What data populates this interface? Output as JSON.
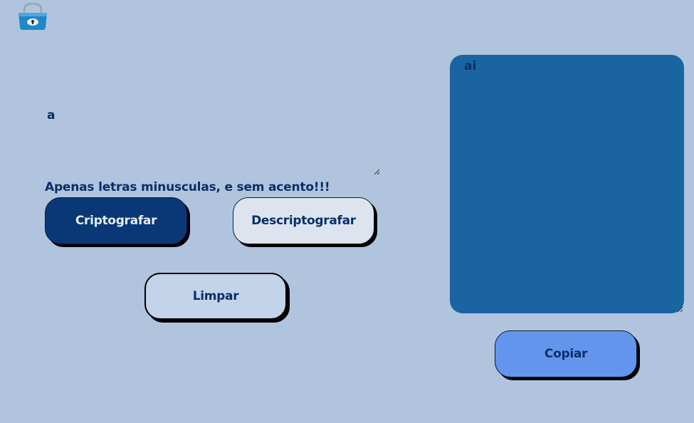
{
  "logo": {
    "icon": "padlock-icon"
  },
  "input": {
    "value": "a",
    "resize_icon": "resize-grip-icon"
  },
  "warning_text": "Apenas letras minusculas, e sem acento!!!",
  "buttons": {
    "encrypt_label": "Criptografar",
    "decrypt_label": "Descriptografar",
    "clear_label": "Limpar",
    "copy_label": "Copiar"
  },
  "output": {
    "value": "ai",
    "resize_icon": "resize-grip-icon"
  },
  "colors": {
    "background": "#b0c4de",
    "primary_dark": "#0a3877",
    "output_panel": "#1a64a1",
    "copy_button": "#6495ed",
    "text_dark": "#0a2f6a"
  }
}
